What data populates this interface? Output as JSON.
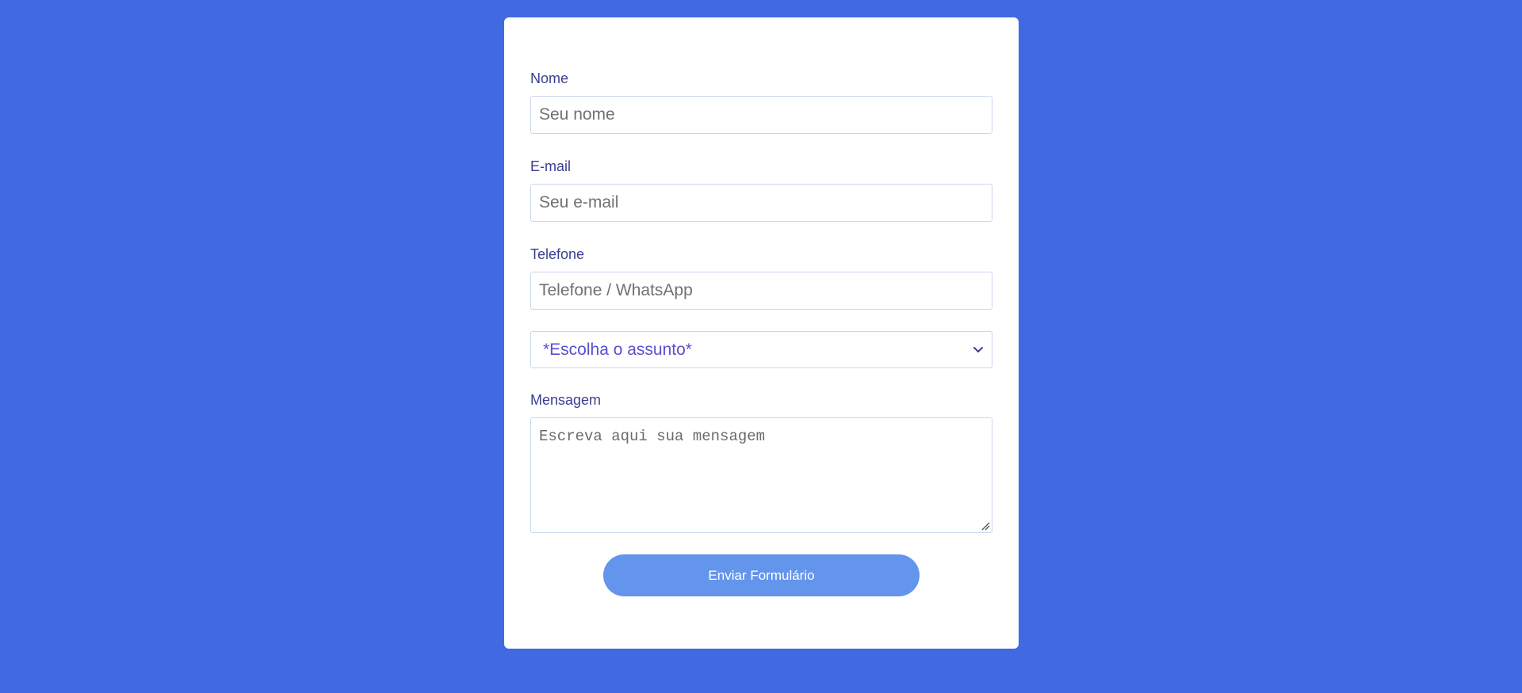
{
  "form": {
    "name": {
      "label": "Nome",
      "placeholder": "Seu nome"
    },
    "email": {
      "label": "E-mail",
      "placeholder": "Seu e-mail"
    },
    "phone": {
      "label": "Telefone",
      "placeholder": "Telefone / WhatsApp"
    },
    "subject": {
      "selected": "*Escolha o assunto*"
    },
    "message": {
      "label": "Mensagem",
      "placeholder": "Escreva aqui sua mensagem"
    },
    "submit_label": "Enviar Formulário"
  },
  "icons": {
    "select_arrow": "chevron-down-icon",
    "textarea_resize": "resize-grip-icon"
  },
  "colors": {
    "background": "#4169e1",
    "card": "#ffffff",
    "label_text": "#3a3f8f",
    "select_text": "#5a4fcf",
    "button": "#6495ed",
    "input_border": "#c9d6ee"
  }
}
